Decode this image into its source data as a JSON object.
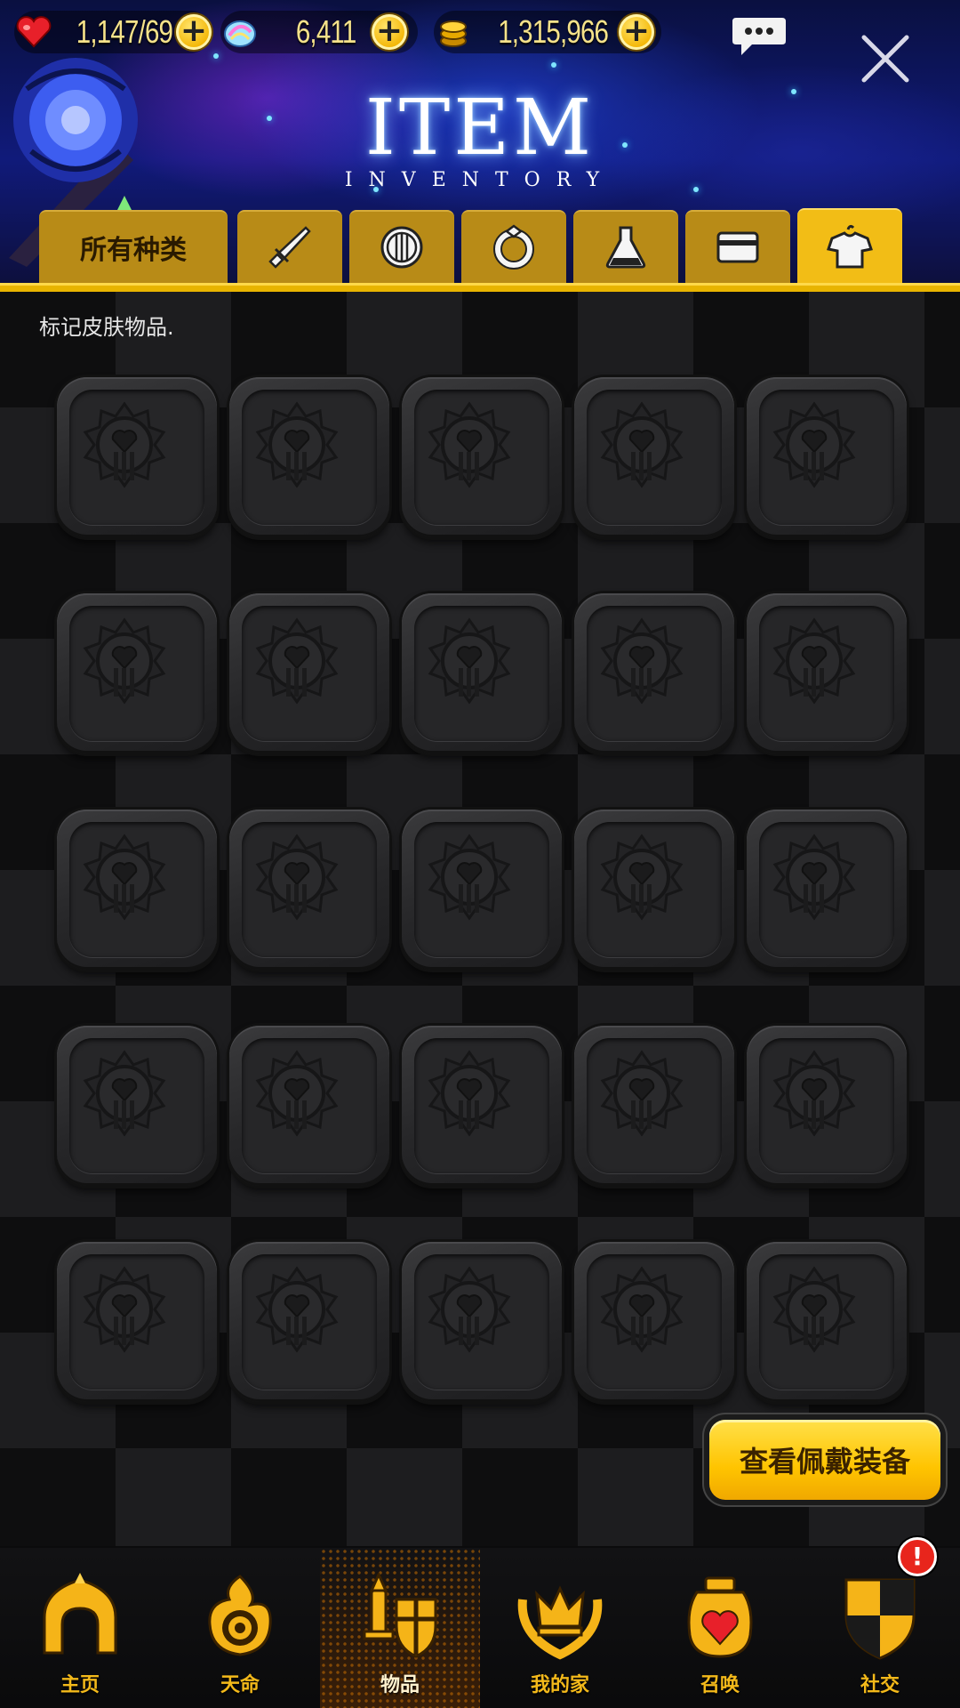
{
  "header": {
    "title": "ITEM",
    "subtitle": "INVENTORY",
    "resources": {
      "hearts": "1,147/69",
      "gems": "6,411",
      "gold": "1,315,966"
    }
  },
  "tabs": [
    {
      "label": "所有种类",
      "icon": "all-categories"
    },
    {
      "label": "",
      "icon": "sword-icon"
    },
    {
      "label": "",
      "icon": "shield-icon"
    },
    {
      "label": "",
      "icon": "ring-icon"
    },
    {
      "label": "",
      "icon": "potion-flask-icon"
    },
    {
      "label": "",
      "icon": "card-icon"
    },
    {
      "label": "",
      "icon": "shirt-hanger-icon",
      "active": true
    }
  ],
  "content": {
    "hint": "标记皮肤物品."
  },
  "grid": {
    "rows": 5,
    "cols": 5,
    "slot_icon": "locked-heart-emblem-icon"
  },
  "view_equipped_button": "查看佩戴装备",
  "bottom_nav": [
    {
      "label": "主页",
      "icon": "home-arch-icon"
    },
    {
      "label": "天命",
      "icon": "flame-eye-icon"
    },
    {
      "label": "物品",
      "icon": "sword-shield-icon",
      "active": true
    },
    {
      "label": "我的家",
      "icon": "crown-laurel-icon"
    },
    {
      "label": "召唤",
      "icon": "heart-jar-icon"
    },
    {
      "label": "社交",
      "icon": "quartered-shield-icon"
    }
  ],
  "alert_badge": "!",
  "colors": {
    "accent": "#f2bd16",
    "tab": "#b88b17",
    "nav_label": "#f3b91a",
    "alert": "#e8251c"
  }
}
